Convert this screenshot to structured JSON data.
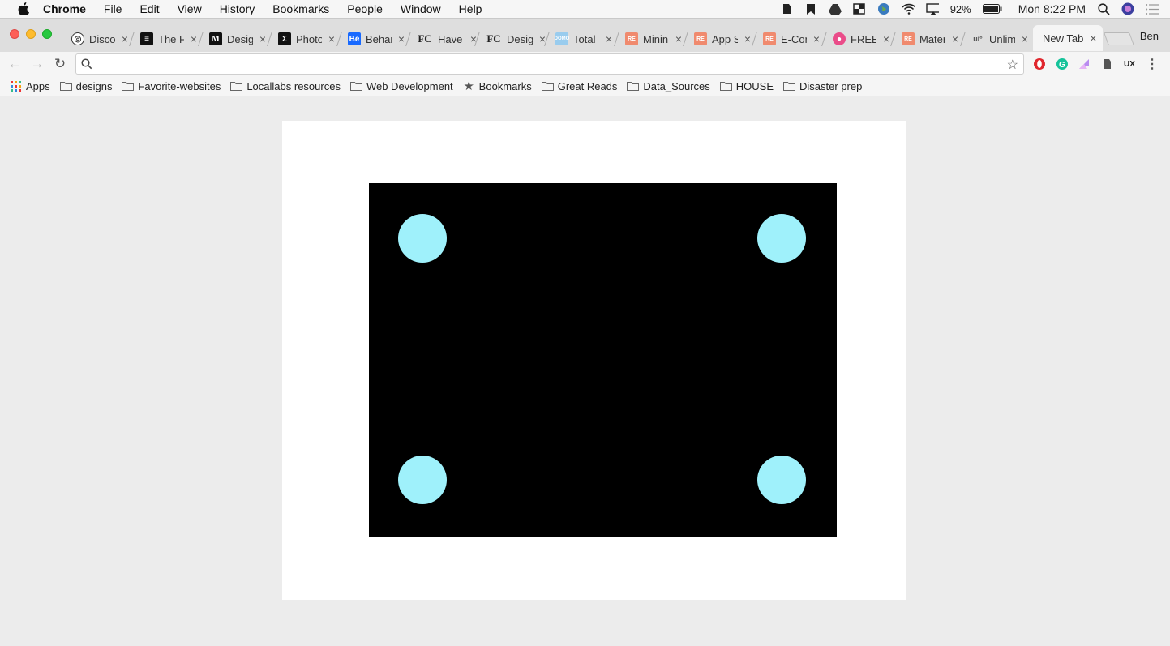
{
  "menubar": {
    "app_name": "Chrome",
    "items": [
      "File",
      "Edit",
      "View",
      "History",
      "Bookmarks",
      "People",
      "Window",
      "Help"
    ],
    "battery": "92%",
    "clock": "Mon 8:22 PM"
  },
  "tabs": [
    {
      "title": "Disco",
      "favicon": "discord-icon"
    },
    {
      "title": "The F",
      "favicon": "document-icon"
    },
    {
      "title": "Desig",
      "favicon": "medium-icon"
    },
    {
      "title": "Photo",
      "favicon": "photo-icon"
    },
    {
      "title": "Behar",
      "favicon": "behance-icon"
    },
    {
      "title": "Have",
      "favicon": "fc-icon"
    },
    {
      "title": "Desig",
      "favicon": "fc-icon"
    },
    {
      "title": "Total",
      "favicon": "domo-icon"
    },
    {
      "title": "Minin",
      "favicon": "repo-icon"
    },
    {
      "title": "App S",
      "favicon": "repo-icon"
    },
    {
      "title": "E-Cor",
      "favicon": "repo-icon"
    },
    {
      "title": "FREE",
      "favicon": "dribbble-icon"
    },
    {
      "title": "Mater",
      "favicon": "repo-icon"
    },
    {
      "title": "Unlim",
      "favicon": "ui-icon"
    }
  ],
  "active_tab": {
    "title": "New Tab"
  },
  "profile_name": "Ben",
  "omnibox": {
    "value": "",
    "placeholder": ""
  },
  "bookmarks": [
    {
      "label": "Apps",
      "icon": "apps-grid-icon"
    },
    {
      "label": "designs",
      "icon": "folder-icon"
    },
    {
      "label": "Favorite-websites",
      "icon": "folder-icon"
    },
    {
      "label": "Locallabs resources",
      "icon": "folder-icon"
    },
    {
      "label": "Web Development",
      "icon": "folder-icon"
    },
    {
      "label": "Bookmarks",
      "icon": "star-icon"
    },
    {
      "label": "Great Reads",
      "icon": "folder-icon"
    },
    {
      "label": "Data_Sources",
      "icon": "folder-icon"
    },
    {
      "label": "HOUSE",
      "icon": "folder-icon"
    },
    {
      "label": "Disaster prep",
      "icon": "folder-icon"
    }
  ],
  "colors": {
    "canvas": "#000000",
    "dot": "#9ff1fb",
    "card": "#ffffff"
  }
}
